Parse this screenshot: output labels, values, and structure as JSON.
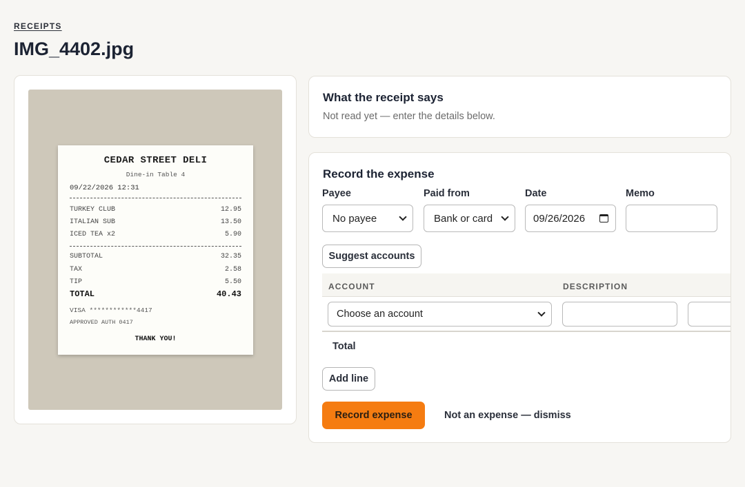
{
  "breadcrumb": "RECEIPTS",
  "title": "IMG_4402.jpg",
  "receipt_image": {
    "store": "CEDAR STREET DELI",
    "subtitle": "Dine-in Table 4",
    "datetime": "09/22/2026 12:31",
    "items": [
      {
        "name": "TURKEY CLUB",
        "price": "12.95"
      },
      {
        "name": "ITALIAN SUB",
        "price": "13.50"
      },
      {
        "name": "ICED TEA x2",
        "price": "5.90"
      }
    ],
    "subtotal": {
      "label": "SUBTOTAL",
      "value": "32.35"
    },
    "tax": {
      "label": "TAX",
      "value": "2.58"
    },
    "tip": {
      "label": "TIP",
      "value": "5.50"
    },
    "total": {
      "label": "TOTAL",
      "value": "40.43"
    },
    "card": "VISA ************4417",
    "auth": "APPROVED AUTH 0417",
    "thanks": "THANK YOU!"
  },
  "says": {
    "heading": "What the receipt says",
    "text": "Not read yet — enter the details below."
  },
  "expense": {
    "heading": "Record the expense",
    "payee": {
      "label": "Payee",
      "value": "No payee"
    },
    "paid_from": {
      "label": "Paid from",
      "value": "Bank or card"
    },
    "date": {
      "label": "Date",
      "value": "09/26/2026"
    },
    "memo": {
      "label": "Memo",
      "value": ""
    },
    "suggest_button": "Suggest accounts",
    "table": {
      "col_account": "ACCOUNT",
      "col_description": "DESCRIPTION",
      "row_account_value": "Choose an account"
    },
    "total_label": "Total",
    "add_line_button": "Add line",
    "record_button": "Record expense",
    "dismiss_link": "Not an expense — dismiss"
  },
  "colors": {
    "accent": "#f57c11",
    "page_bg": "#f7f6f3"
  }
}
